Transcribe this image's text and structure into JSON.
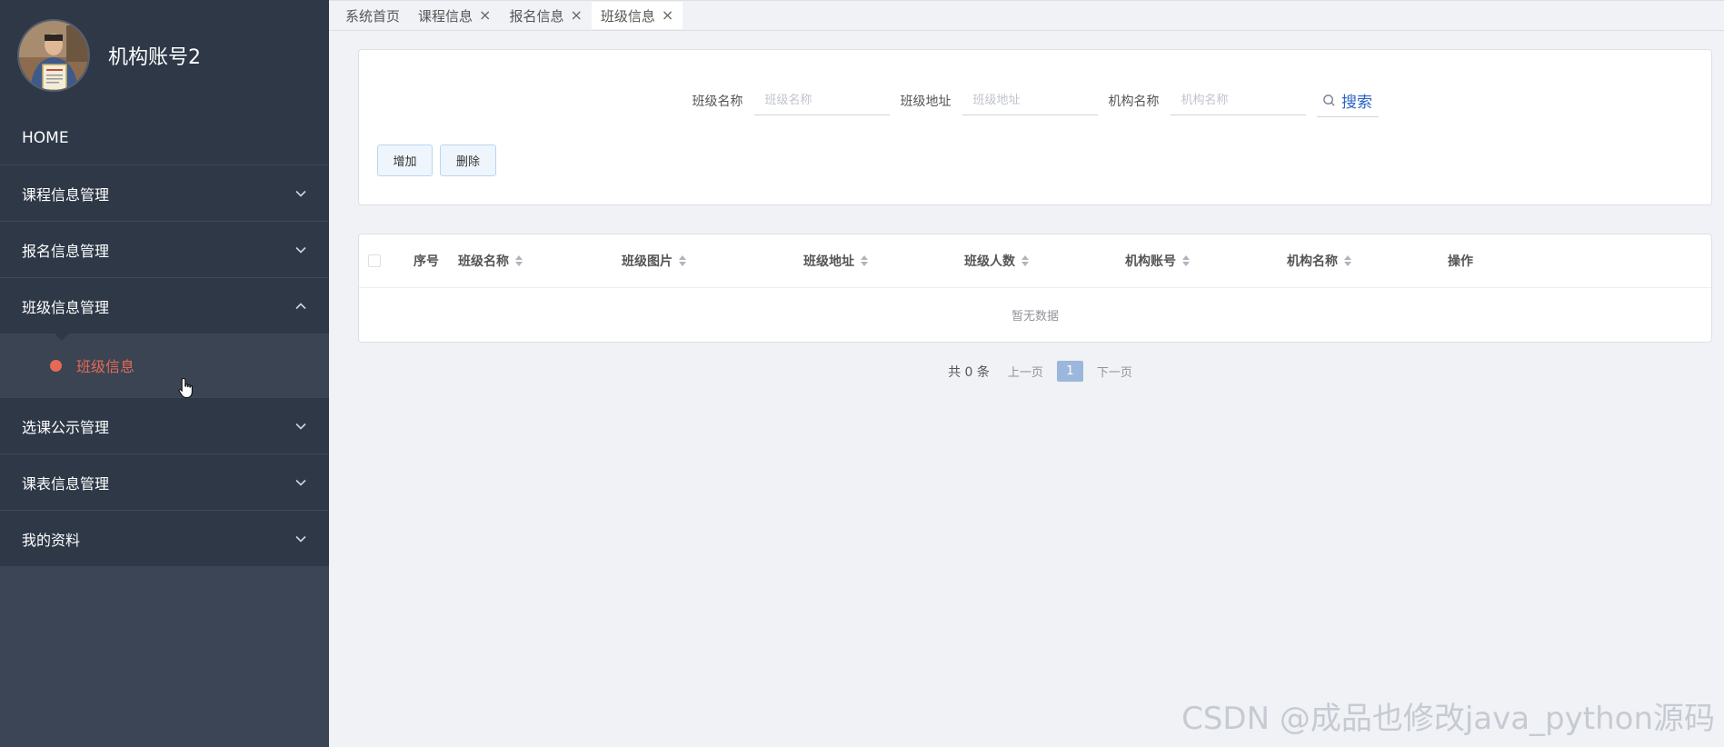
{
  "profile": {
    "name": "机构账号2"
  },
  "sidebar": {
    "items": [
      {
        "label": "HOME"
      },
      {
        "label": "课程信息管理"
      },
      {
        "label": "报名信息管理"
      },
      {
        "label": "班级信息管理",
        "expanded": true,
        "submenu": [
          {
            "label": "班级信息"
          }
        ]
      },
      {
        "label": "选课公示管理"
      },
      {
        "label": "课表信息管理"
      },
      {
        "label": "我的资料"
      }
    ]
  },
  "tabs": [
    {
      "label": "系统首页",
      "closable": false
    },
    {
      "label": "课程信息",
      "closable": true
    },
    {
      "label": "报名信息",
      "closable": true
    },
    {
      "label": "班级信息",
      "closable": true,
      "active": true
    }
  ],
  "search": {
    "fields": [
      {
        "label": "班级名称",
        "placeholder": "班级名称",
        "value": ""
      },
      {
        "label": "班级地址",
        "placeholder": "班级地址",
        "value": ""
      },
      {
        "label": "机构名称",
        "placeholder": "机构名称",
        "value": ""
      }
    ],
    "button": "搜索"
  },
  "actions": {
    "add": "增加",
    "delete": "删除"
  },
  "table": {
    "columns": [
      "序号",
      "班级名称",
      "班级图片",
      "班级地址",
      "班级人数",
      "机构账号",
      "机构名称",
      "操作"
    ],
    "empty_text": "暂无数据",
    "rows": []
  },
  "pagination": {
    "total": "共 0 条",
    "prev": "上一页",
    "page": "1",
    "next": "下一页"
  },
  "watermark": "CSDN @成品也修改java_python源码",
  "colors": {
    "sidebar": "#2e3847",
    "accent": "#e56a55",
    "search": "#2b63c5",
    "page": "#9bb7db"
  }
}
